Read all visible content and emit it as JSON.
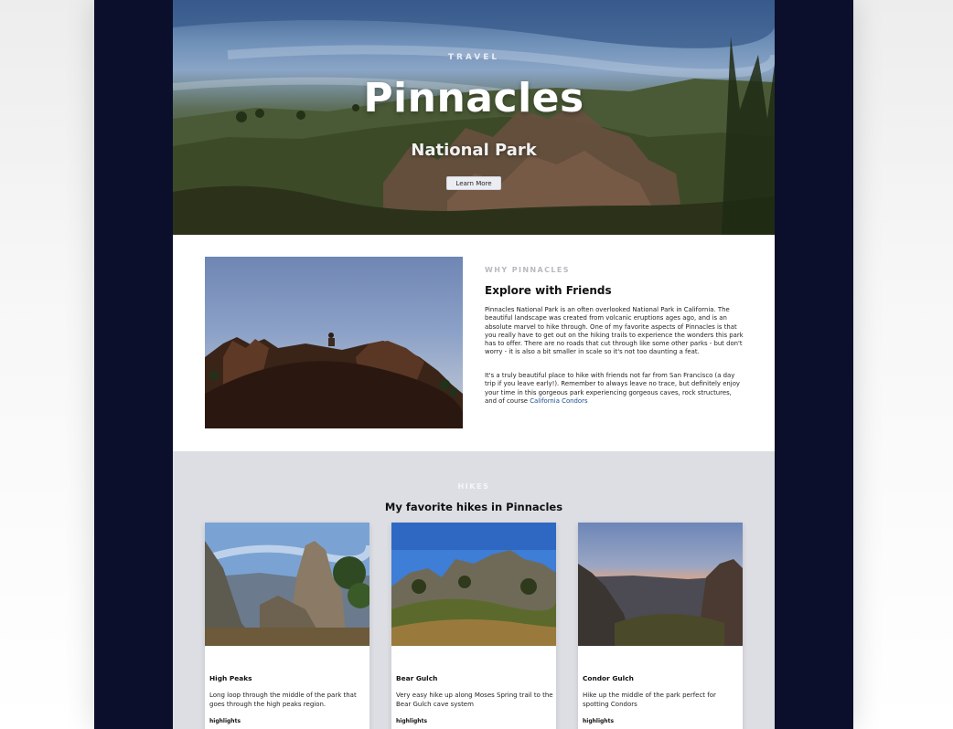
{
  "hero": {
    "eyebrow": "TRAVEL",
    "title": "Pinnacles",
    "subtitle": "National Park",
    "button_label": "Learn More"
  },
  "why": {
    "eyebrow": "WHY PINNACLES",
    "heading": "Explore with Friends",
    "paragraph_1": "Pinnacles National Park is an often overlooked National Park in California. The beautiful landscape was created from volcanic eruptions ages ago, and is an absolute marvel to hike through. One of my favorite aspects of Pinnacles is that you really have to get out on the hiking trails to experience the wonders this park has to offer. There are no roads that cut through like some other parks - but don't worry - it is also a bit smaller in scale so it's not too daunting a feat.",
    "paragraph_2": "It's a truly beautiful place to hike with friends not far from San Francisco (a day trip if you leave early!). Remember to always leave no trace, but definitely enjoy your time in this gorgeous park experiencing gorgeous caves, rock structures, and of course ",
    "link_text": "California Condors"
  },
  "hikes": {
    "eyebrow": "HIKES",
    "heading": "My favorite hikes in Pinnacles",
    "cards": [
      {
        "title": "High Peaks",
        "description": "Long loop through the middle of the park that goes through the high peaks region.",
        "meta": "highlights"
      },
      {
        "title": "Bear Gulch",
        "description": "Very easy hike up along Moses Spring trail to the Bear Gulch cave system",
        "meta": "highlights"
      },
      {
        "title": "Condor Gulch",
        "description": "Hike up the middle of the park perfect for spotting Condors",
        "meta": "highlights"
      }
    ]
  },
  "colors": {
    "frame_background": "#0b0f2b",
    "hikes_background": "#dddee4",
    "link": "#1d4b8f",
    "eyebrow_gray": "#b8b9c1"
  }
}
